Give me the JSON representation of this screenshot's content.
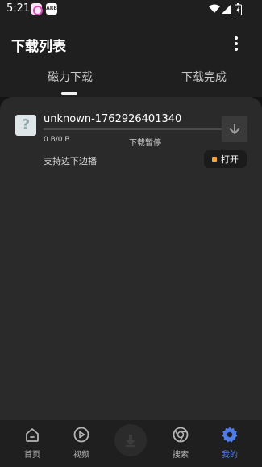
{
  "status_bar": {
    "time": "5:21",
    "app_badge": "ARB"
  },
  "app_bar": {
    "title": "下载列表",
    "more_icon": "more-vertical-icon"
  },
  "tabs": [
    {
      "label": "磁力下载",
      "active": true
    },
    {
      "label": "下载完成",
      "active": false
    }
  ],
  "download_item": {
    "file_icon": "unknown-file-icon",
    "file_icon_glyph": "?",
    "name": "unknown-1762926401340",
    "progress": 0,
    "size_text": "0 B/0 B",
    "status": "下载暂停",
    "feature_text": "支持边下边播",
    "action_icon": "download-arrow-icon",
    "open_label": "打开"
  },
  "bottom_nav": {
    "items": [
      {
        "label": "首页",
        "icon": "home-icon",
        "active": false
      },
      {
        "label": "视频",
        "icon": "play-icon",
        "active": false
      },
      {
        "label": "搜索",
        "icon": "browser-icon",
        "active": false
      },
      {
        "label": "我的",
        "icon": "gear-icon",
        "active": true
      }
    ],
    "center_icon": "download-icon"
  },
  "colors": {
    "background": "#141414",
    "panel": "#2a2a2a",
    "accent": "#4f7de8",
    "open_dot": "#f4a53b"
  }
}
